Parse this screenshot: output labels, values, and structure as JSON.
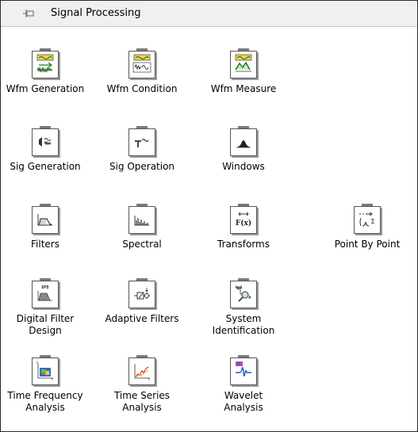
{
  "palette": {
    "title": "Signal Processing",
    "items": [
      {
        "label": "Wfm Generation",
        "icon": "waveform-generation-icon"
      },
      {
        "label": "Wfm Condition",
        "icon": "waveform-condition-icon"
      },
      {
        "label": "Wfm Measure",
        "icon": "waveform-measure-icon"
      },
      {
        "label": "Sig Generation",
        "icon": "signal-generation-icon"
      },
      {
        "label": "Sig Operation",
        "icon": "signal-operation-icon"
      },
      {
        "label": "Windows",
        "icon": "windows-icon"
      },
      {
        "label": "Filters",
        "icon": "filters-icon"
      },
      {
        "label": "Spectral",
        "icon": "spectral-icon"
      },
      {
        "label": "Transforms",
        "icon": "transforms-icon"
      },
      {
        "label": "Point By Point",
        "icon": "point-by-point-icon"
      },
      {
        "label": "Digital Filter\nDesign",
        "icon": "digital-filter-design-icon",
        "badge": "DFD"
      },
      {
        "label": "Adaptive Filters",
        "icon": "adaptive-filters-icon"
      },
      {
        "label": "System\nIdentification",
        "icon": "system-identification-icon"
      },
      {
        "label": "Time Frequency\nAnalysis",
        "icon": "time-frequency-analysis-icon"
      },
      {
        "label": "Time Series\nAnalysis",
        "icon": "time-series-analysis-icon"
      },
      {
        "label": "Wavelet\nAnalysis",
        "icon": "wavelet-analysis-icon"
      }
    ]
  }
}
